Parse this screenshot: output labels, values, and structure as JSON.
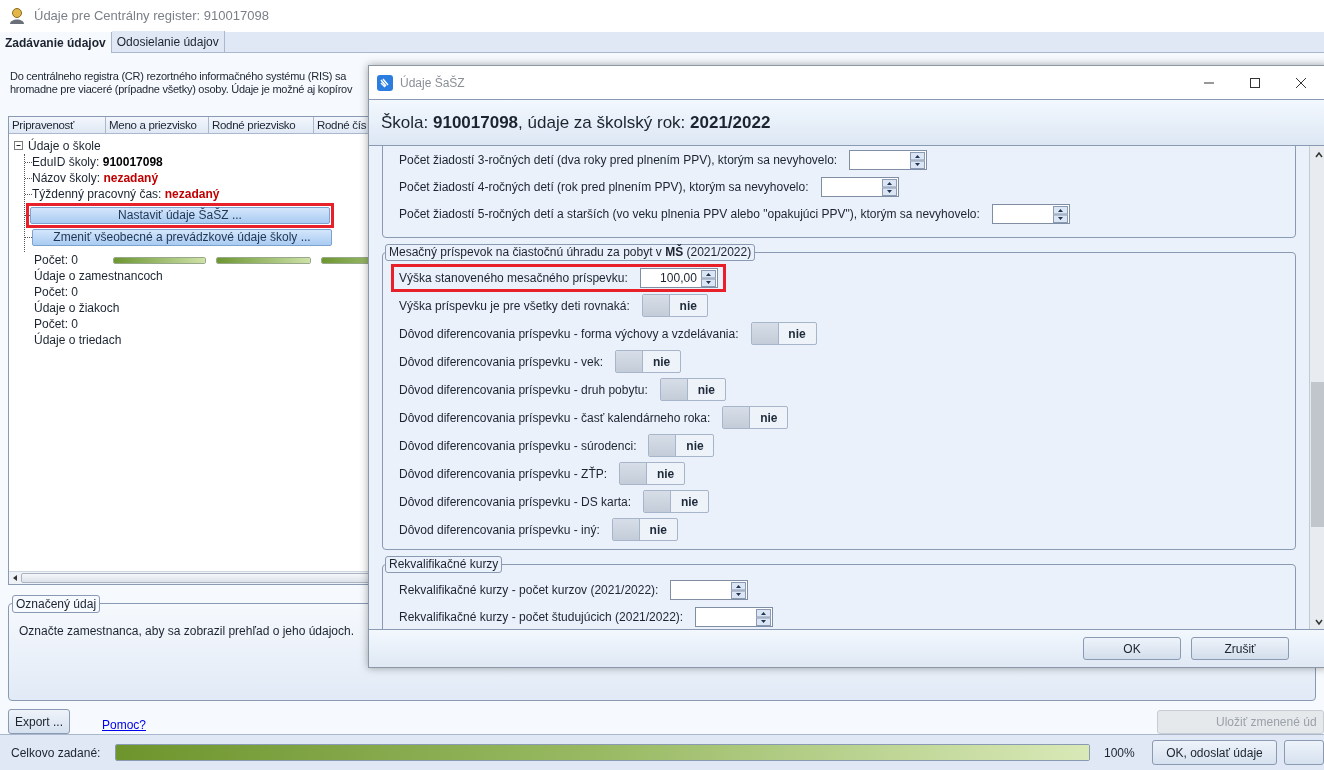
{
  "window": {
    "title": "Údaje pre Centrálny register: 910017098"
  },
  "tabs": [
    {
      "label": "Zadávanie údajov",
      "selected": true
    },
    {
      "label": "Odosielanie údajov",
      "selected": false
    }
  ],
  "description": [
    "Do centrálneho registra (CR) rezortného informačného systému (RIS) sa",
    "hromadne pre viaceré (prípadne všetky) osoby. Údaje je možné aj kopírov"
  ],
  "grid": {
    "columns": [
      "Pripravenosť",
      "Meno a priezvisko",
      "Rodné priezvisko",
      "Rodné čís"
    ],
    "tree": {
      "label": "Údaje o škole",
      "expanded": true,
      "children": [
        {
          "kind": "field",
          "label": "EduID školy:",
          "value": "910017098",
          "missing": false
        },
        {
          "kind": "field",
          "label": "Názov školy:",
          "value": "nezadaný",
          "missing": true
        },
        {
          "kind": "field",
          "label": "Týždenný pracovný čas:",
          "value": "nezadaný",
          "missing": true
        },
        {
          "kind": "button",
          "label": "Nastaviť údaje ŠaŠZ ...",
          "highlighted": true
        },
        {
          "kind": "button",
          "label": "Zmeniť všeobecné a prevádzkové údaje školy ...",
          "highlighted": false
        }
      ]
    },
    "rows": [
      {
        "label": "Počet: 0",
        "bars": [
          {
            "level": 1
          },
          {
            "level": 1
          },
          {
            "level": 1
          }
        ]
      },
      {
        "label": "Údaje o zamestnancoch"
      },
      {
        "label": "Počet: 0"
      },
      {
        "label": "Údaje o žiakoch"
      },
      {
        "label": "Počet: 0"
      },
      {
        "label": "Údaje o triedach"
      }
    ]
  },
  "selected_item": {
    "title": "Označený údaj",
    "text": "Označte zamestnanca, aby sa zobrazil prehľad o jeho údajoch."
  },
  "export_button": "Export ...",
  "help_link": "Pomoc?",
  "save_button": {
    "label": "Uložiť zmenené úd",
    "disabled": true
  },
  "status": {
    "label": "Celkovo zadané:",
    "level": 1,
    "reading": "100%",
    "send_button": "OK, odoslať údaje"
  },
  "dialog": {
    "title": "Údaje ŠaŠZ",
    "header": "Škola: **910017098**, údaje za školský rok: **2021/2022**",
    "groups": [
      {
        "rows": [
          {
            "kind": "spin",
            "label": "Počet žiadostí 3-ročných detí (dva roky pred plnením PPV), ktorým sa nevyhovelo:",
            "highlighted": false
          },
          {
            "kind": "spin",
            "label": "Počet žiadostí 4-ročných detí (rok pred plnením PPV), ktorým sa nevyhovelo:",
            "highlighted": false
          },
          {
            "kind": "spin",
            "label": "Počet žiadostí 5-ročných detí a starších (vo veku plnenia PPV alebo \"opakujúci PPV\"), ktorým sa nevyhovelo:",
            "highlighted": false
          }
        ]
      },
      {
        "title": "Mesačný príspevok na čiastočnú úhradu za pobyt v **MŠ** (2021/2022)",
        "rows": [
          {
            "kind": "spin",
            "label": "Výška stanoveného mesačného príspevku:",
            "value": "100,00",
            "highlighted": true
          },
          {
            "kind": "toggle",
            "label": "Výška príspevku je pre všetky deti rovnaká:",
            "text": "nie",
            "on": false
          },
          {
            "kind": "toggle",
            "label": "Dôvod diferencovania príspevku - forma výchovy a vzdelávania:",
            "text": "nie",
            "on": false
          },
          {
            "kind": "toggle",
            "label": "Dôvod diferencovania príspevku - vek:",
            "text": "nie",
            "on": false
          },
          {
            "kind": "toggle",
            "label": "Dôvod diferencovania príspevku - druh pobytu:",
            "text": "nie",
            "on": false
          },
          {
            "kind": "toggle",
            "label": "Dôvod diferencovania príspevku - časť kalendárneho roka:",
            "text": "nie",
            "on": false
          },
          {
            "kind": "toggle",
            "label": "Dôvod diferencovania príspevku - súrodenci:",
            "text": "nie",
            "on": false
          },
          {
            "kind": "toggle",
            "label": "Dôvod diferencovania príspevku - ZŤP:",
            "text": "nie",
            "on": false
          },
          {
            "kind": "toggle",
            "label": "Dôvod diferencovania príspevku - DS karta:",
            "text": "nie",
            "on": false
          },
          {
            "kind": "toggle",
            "label": "Dôvod diferencovania príspevku - iný:",
            "text": "nie",
            "on": false
          }
        ]
      },
      {
        "title": "Rekvalifikačné kurzy",
        "rows": [
          {
            "kind": "spin",
            "label": "Rekvalifikačné kurzy - počet kurzov (2021/2022):",
            "highlighted": false
          },
          {
            "kind": "spin",
            "label": "Rekvalifikačné kurzy - počet študujúcich (2021/2022):",
            "highlighted": false
          }
        ]
      }
    ],
    "buttons": [
      "OK",
      "Zrušiť"
    ]
  }
}
